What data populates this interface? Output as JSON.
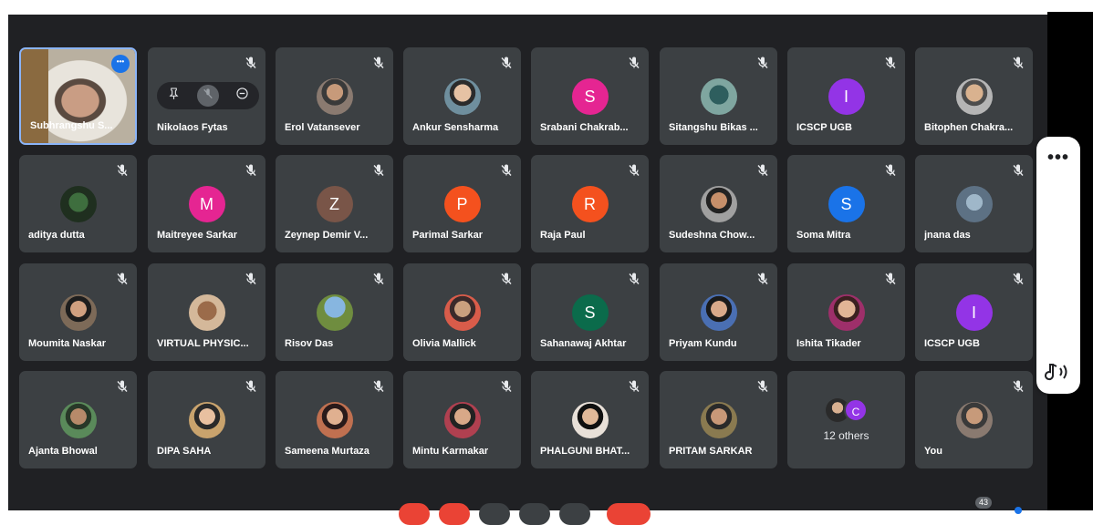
{
  "meeting": {
    "self_tile": {
      "name": "Subhrangshu S..."
    },
    "pinned_tile": {
      "name": "Nikolaos Fytas"
    },
    "participants": [
      {
        "name": "Erol Vatansever",
        "avatar_type": "photo"
      },
      {
        "name": "Ankur Sensharma",
        "avatar_type": "photo"
      },
      {
        "name": "Srabani Chakrab...",
        "avatar_type": "letter",
        "letter": "S",
        "color": "#e52592"
      },
      {
        "name": "Sitangshu Bikas ...",
        "avatar_type": "photo"
      },
      {
        "name": "ICSCP UGB",
        "avatar_type": "letter",
        "letter": "I",
        "color": "#9334e6"
      },
      {
        "name": "Bitophen Chakra...",
        "avatar_type": "photo"
      },
      {
        "name": "aditya dutta",
        "avatar_type": "photo"
      },
      {
        "name": "Maitreyee Sarkar",
        "avatar_type": "letter",
        "letter": "M",
        "color": "#e52592"
      },
      {
        "name": "Zeynep Demir V...",
        "avatar_type": "letter",
        "letter": "Z",
        "color": "#795548"
      },
      {
        "name": "Parimal Sarkar",
        "avatar_type": "letter",
        "letter": "P",
        "color": "#f4511e"
      },
      {
        "name": "Raja Paul",
        "avatar_type": "letter",
        "letter": "R",
        "color": "#f4511e"
      },
      {
        "name": "Sudeshna Chow...",
        "avatar_type": "photo"
      },
      {
        "name": "Soma Mitra",
        "avatar_type": "letter",
        "letter": "S",
        "color": "#1a73e8"
      },
      {
        "name": "jnana das",
        "avatar_type": "photo"
      },
      {
        "name": "Moumita Naskar",
        "avatar_type": "photo"
      },
      {
        "name": "VIRTUAL PHYSIC...",
        "avatar_type": "photo"
      },
      {
        "name": "Risov Das",
        "avatar_type": "photo"
      },
      {
        "name": "Olivia Mallick",
        "avatar_type": "photo"
      },
      {
        "name": "Sahanawaj Akhtar",
        "avatar_type": "letter",
        "letter": "S",
        "color": "#0b6b4b"
      },
      {
        "name": "Priyam Kundu",
        "avatar_type": "photo"
      },
      {
        "name": "Ishita Tikader",
        "avatar_type": "photo"
      },
      {
        "name": "ICSCP UGB",
        "avatar_type": "letter",
        "letter": "I",
        "color": "#9334e6"
      },
      {
        "name": "Ajanta Bhowal",
        "avatar_type": "photo"
      },
      {
        "name": "DIPA SAHA",
        "avatar_type": "photo"
      },
      {
        "name": "Sameena Murtaza",
        "avatar_type": "photo"
      },
      {
        "name": "Mintu Karmakar",
        "avatar_type": "photo"
      },
      {
        "name": "PHALGUNI BHAT...",
        "avatar_type": "photo"
      },
      {
        "name": "PRITAM SARKAR",
        "avatar_type": "photo"
      }
    ],
    "others_tile": {
      "label": "12 others",
      "letter": "C"
    },
    "you_tile": {
      "name": "You"
    },
    "side_panel": {
      "more_label": "•••"
    },
    "people_count": "43",
    "icons": {
      "mic_off": "mic-off-icon",
      "pin": "pin-icon",
      "remove": "remove-icon",
      "more": "more-options-icon",
      "sound": "audio-icon"
    }
  }
}
